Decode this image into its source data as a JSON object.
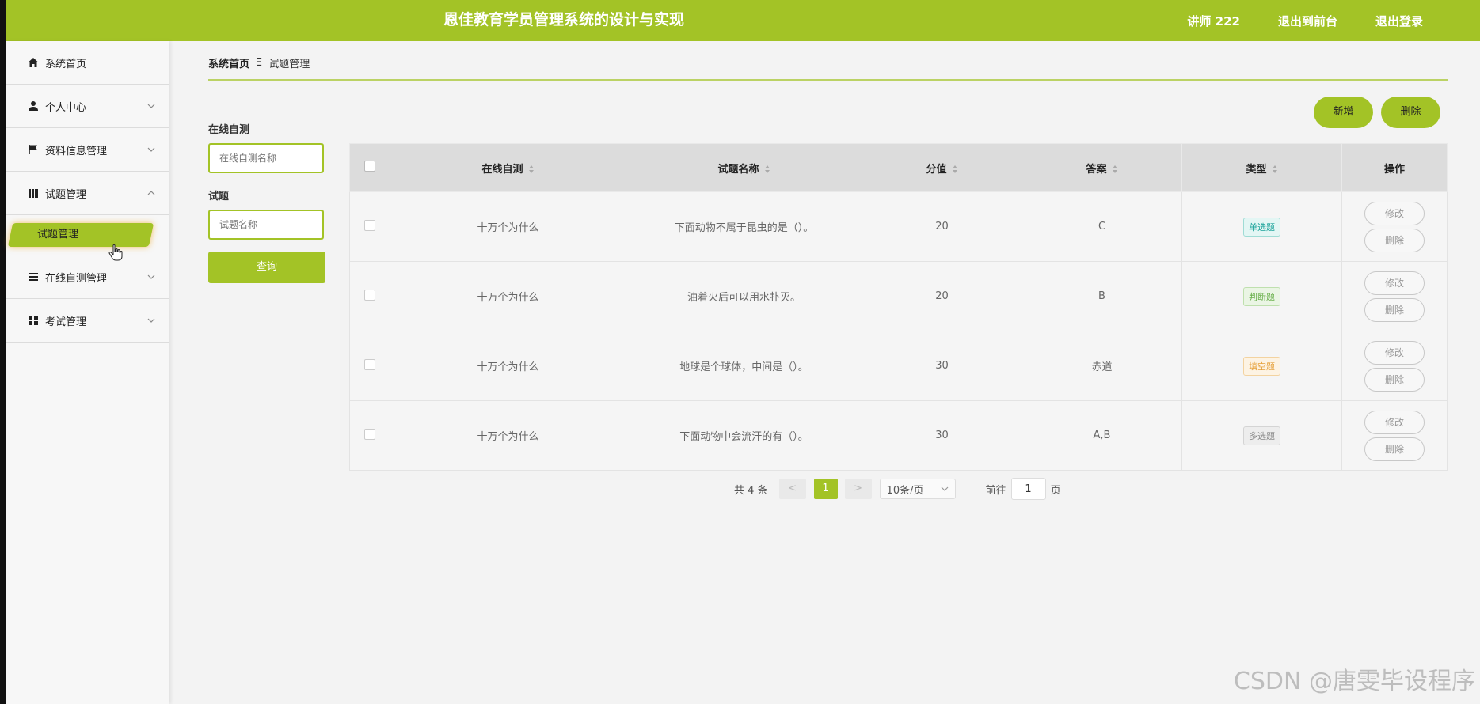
{
  "header": {
    "title": "恩佳教育学员管理系统的设计与实现",
    "user_label": "讲师 222",
    "back_front_label": "退出到前台",
    "logout_label": "退出登录"
  },
  "sidebar": {
    "items": [
      {
        "label": "系统首页",
        "icon": "home-icon"
      },
      {
        "label": "个人中心",
        "icon": "user-icon"
      },
      {
        "label": "资料信息管理",
        "icon": "flag-icon"
      },
      {
        "label": "试题管理",
        "icon": "book-icon"
      },
      {
        "label": "在线自测管理",
        "icon": "list-icon"
      },
      {
        "label": "考试管理",
        "icon": "grid-icon"
      }
    ],
    "active_sub": "试题管理"
  },
  "breadcrumb": {
    "home": "系统首页",
    "separator": "Ξ",
    "current": "试题管理"
  },
  "actions": {
    "add_label": "新增",
    "delete_label": "删除"
  },
  "filters": {
    "field1_label": "在线自测",
    "field1_placeholder": "在线自测名称",
    "field2_label": "试题",
    "field2_placeholder": "试题名称",
    "query_label": "查询"
  },
  "table": {
    "columns": [
      "在线自测",
      "试题名称",
      "分值",
      "答案",
      "类型",
      "操作"
    ],
    "rows": [
      {
        "exam": "十万个为什么",
        "question": "下面动物不属于昆虫的是（）。",
        "score": "20",
        "answer": "C",
        "type": "单选题"
      },
      {
        "exam": "十万个为什么",
        "question": "油着火后可以用水扑灭。",
        "score": "20",
        "answer": "B",
        "type": "判断题"
      },
      {
        "exam": "十万个为什么",
        "question": "地球是个球体，中间是（）。",
        "score": "30",
        "answer": "赤道",
        "type": "填空题"
      },
      {
        "exam": "十万个为什么",
        "question": "下面动物中会流汗的有（）。",
        "score": "30",
        "answer": "A,B",
        "type": "多选题"
      }
    ],
    "edit_label": "修改",
    "delete_label": "删除"
  },
  "type_colors": {
    "单选题": {
      "fg": "#1aa39a",
      "bg": "#e3f6f4",
      "border": "#9fdcd5"
    },
    "判断题": {
      "fg": "#6ab04c",
      "bg": "#eaf5e4",
      "border": "#bfe0ae"
    },
    "填空题": {
      "fg": "#e6a23c",
      "bg": "#fdf3e3",
      "border": "#f3d3a0"
    },
    "多选题": {
      "fg": "#888888",
      "bg": "#ededed",
      "border": "#d4d4d4"
    }
  },
  "pagination": {
    "total_label": "共 4 条",
    "prev": "<",
    "next": ">",
    "current_page": "1",
    "page_size": "10条/页",
    "goto_label": "前往",
    "goto_value": "1",
    "page_suffix": "页"
  },
  "watermark": "CSDN @唐雯毕设程序",
  "accent_color": "#a3c326"
}
